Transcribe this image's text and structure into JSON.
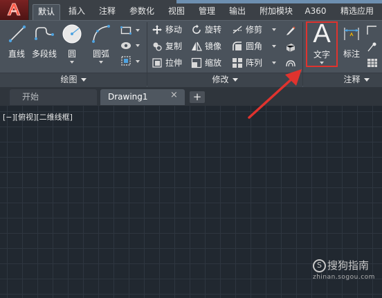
{
  "ribbon_tabs": [
    "默认",
    "插入",
    "注释",
    "参数化",
    "视图",
    "管理",
    "输出",
    "附加模块",
    "A360",
    "精选应用"
  ],
  "draw_panel": {
    "title": "绘图",
    "tools": [
      "直线",
      "多段线",
      "圆",
      "圆弧"
    ]
  },
  "modify_panel": {
    "title": "修改",
    "rows": [
      [
        "移动",
        "旋转",
        "修剪"
      ],
      [
        "复制",
        "镜像",
        "圆角"
      ],
      [
        "拉伸",
        "缩放",
        "阵列"
      ]
    ]
  },
  "annotation_panel": {
    "title": "注释",
    "text_tool": {
      "icon_glyph": "A",
      "label": "文字"
    },
    "dimension_tool": "标注"
  },
  "file_tabs": {
    "start": "开始",
    "drawing": "Drawing1",
    "close_glyph": "×",
    "add_glyph": "+"
  },
  "viewport_label": "[−][俯视][二维线框]",
  "watermark": {
    "brand": "搜狗指南",
    "url": "zhinan.sogou.com"
  },
  "colors": {
    "canvas_bg": "#212830",
    "ribbon_bg": "#4a525b",
    "highlight_box": "#e0332e",
    "arrow": "#e0332e"
  }
}
